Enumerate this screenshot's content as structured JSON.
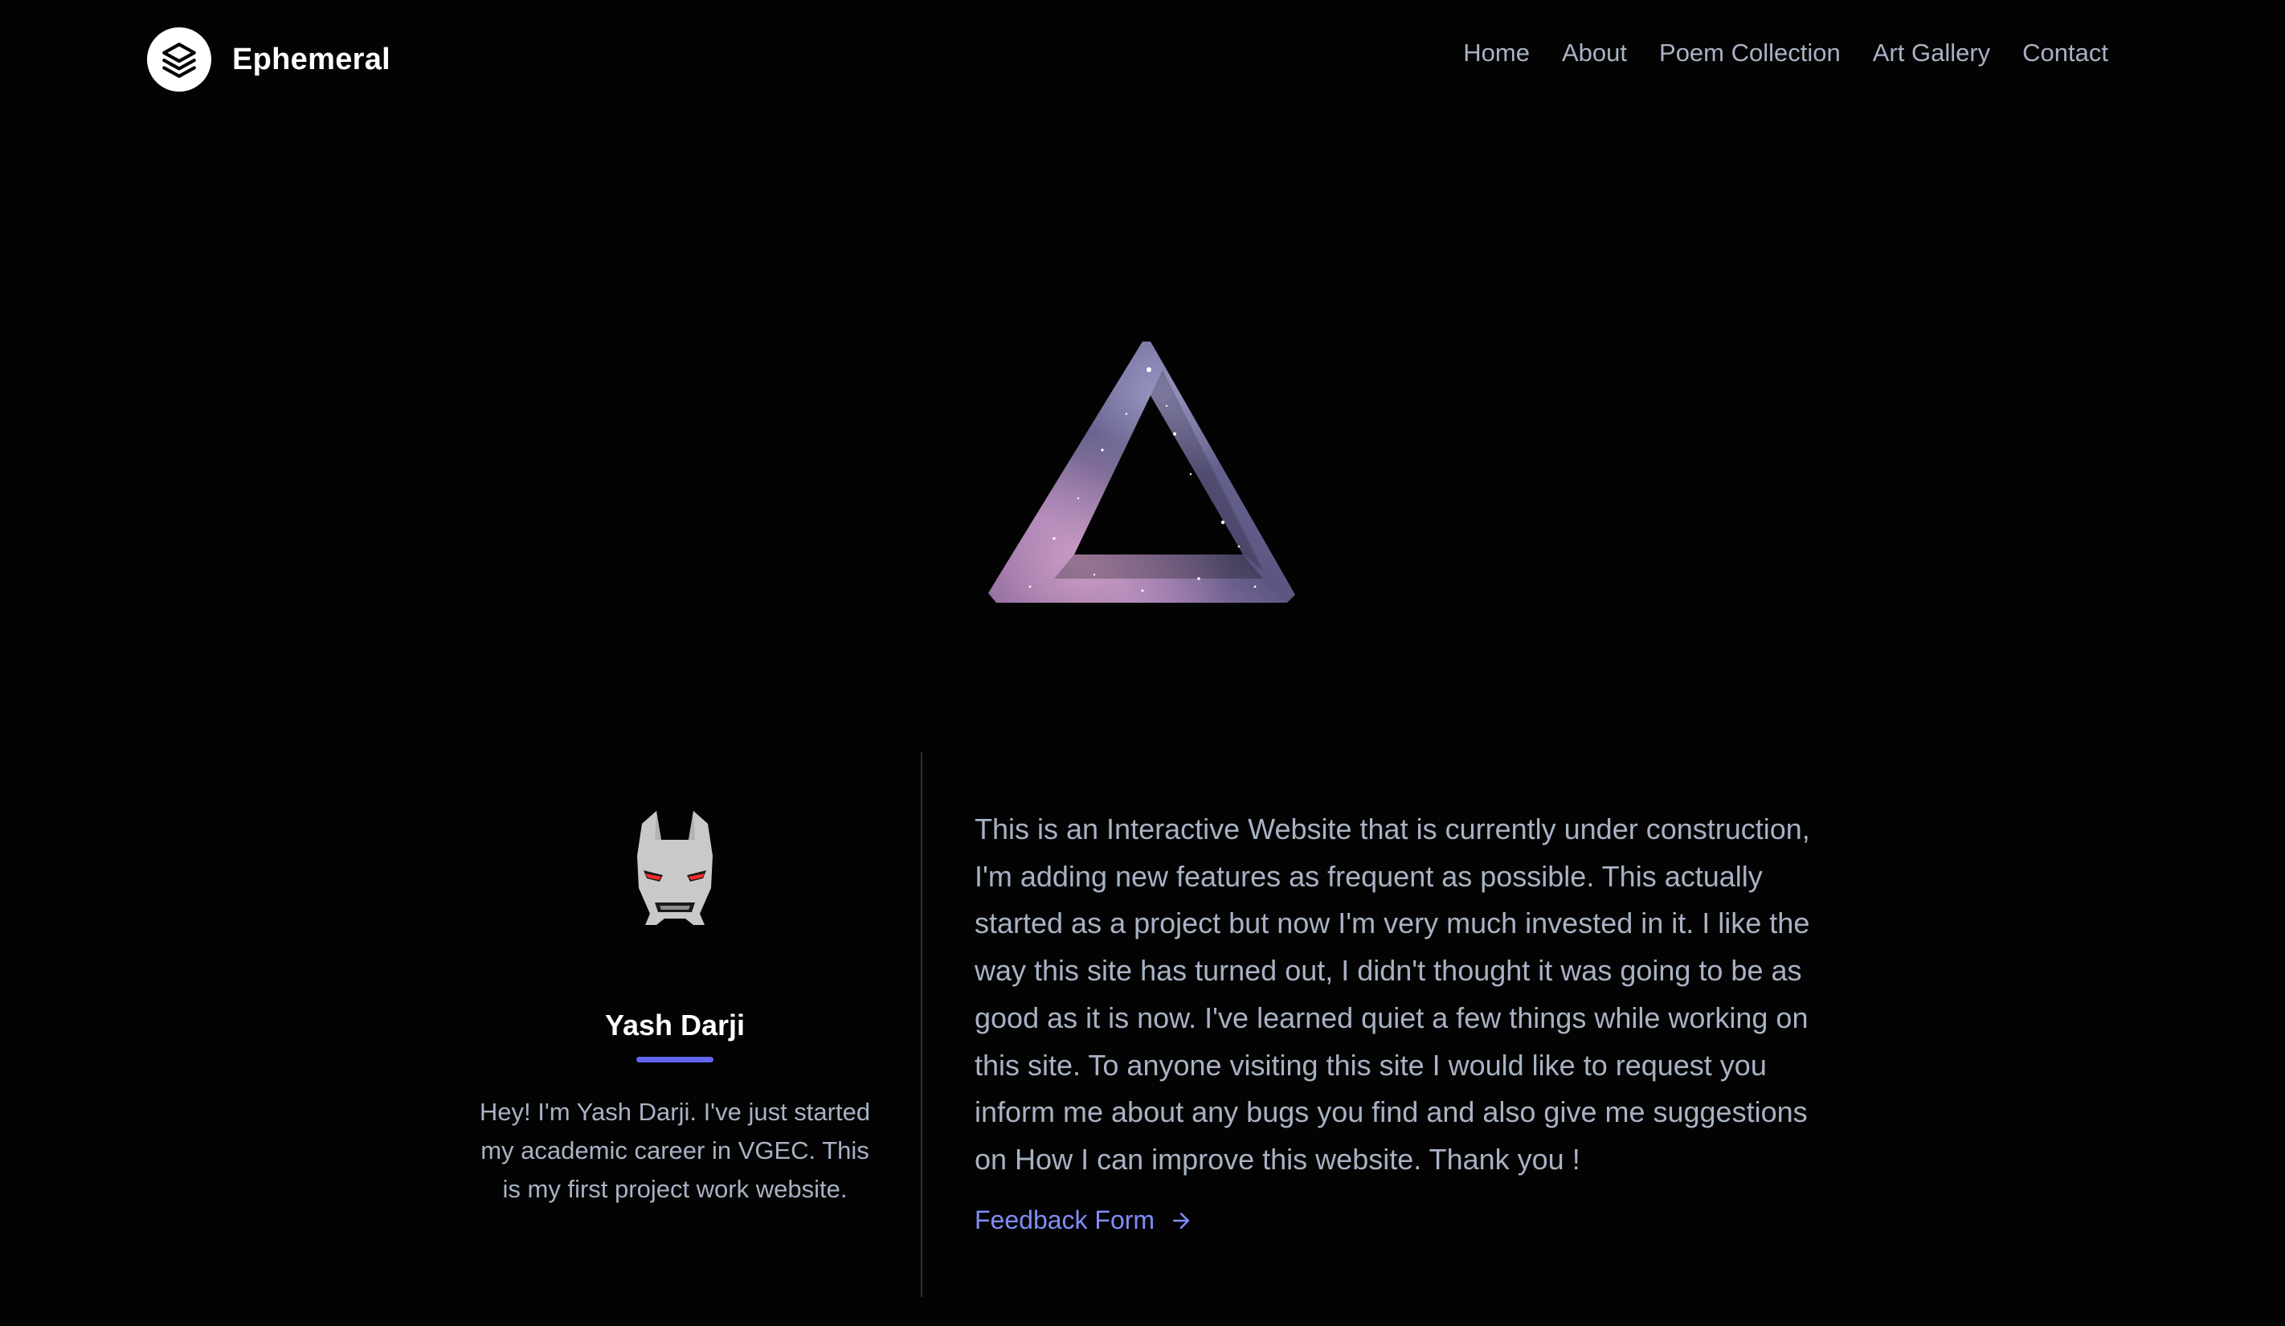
{
  "brand": {
    "name": "Ephemeral",
    "logo_icon": "layers-icon"
  },
  "nav": {
    "items": [
      {
        "label": "Home"
      },
      {
        "label": "About"
      },
      {
        "label": "Poem Collection"
      },
      {
        "label": "Art Gallery"
      },
      {
        "label": "Contact"
      }
    ]
  },
  "hero": {
    "image": "penrose-triangle-galaxy-icon"
  },
  "profile": {
    "avatar_icon": "iron-man-helmet-icon",
    "name": "Yash Darji",
    "bio": "Hey! I'm Yash Darji. I've just started my academic career in VGEC. This is my first project work website."
  },
  "about": {
    "text": "This is an Interactive Website that is currently under construction, I'm adding new features as frequent as possible. This actually started as a project but now I'm very much invested in it. I like the way this site has turned out, I didn't thought it was going to be as good as it is now. I've learned quiet a few things while working on this site. To anyone visiting this site I would like to request you inform me about any bugs you find and also give me suggestions on How I can improve this website. Thank you !",
    "feedback_label": "Feedback Form",
    "feedback_icon": "arrow-right-icon"
  },
  "colors": {
    "background": "#030303",
    "text_muted": "#a8b2c3",
    "accent": "#6366f1",
    "link": "#818cf8"
  }
}
